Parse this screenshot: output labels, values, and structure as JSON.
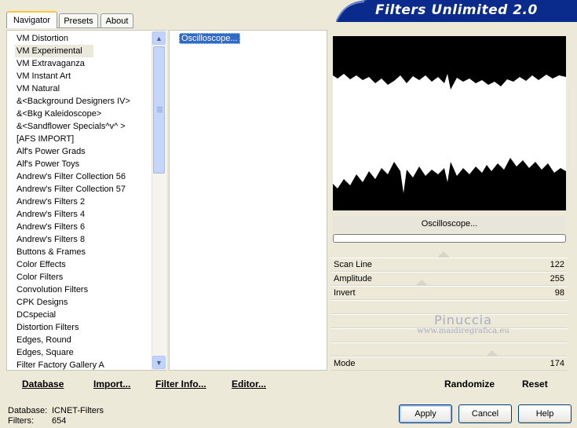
{
  "tabs": [
    {
      "label": "Navigator",
      "active": true
    },
    {
      "label": "Presets",
      "active": false
    },
    {
      "label": "About",
      "active": false
    }
  ],
  "title": "Filters Unlimited 2.0",
  "categories": [
    {
      "label": "VM Distortion",
      "selected": false
    },
    {
      "label": "VM Experimental",
      "selected": true
    },
    {
      "label": "VM Extravaganza",
      "selected": false
    },
    {
      "label": "VM Instant Art",
      "selected": false
    },
    {
      "label": "VM Natural",
      "selected": false
    },
    {
      "label": "&<Background Designers IV>",
      "selected": false
    },
    {
      "label": "&<Bkg Kaleidoscope>",
      "selected": false
    },
    {
      "label": "&<Sandflower Specials^v^ >",
      "selected": false
    },
    {
      "label": "[AFS IMPORT]",
      "selected": false
    },
    {
      "label": "Alf's Power Grads",
      "selected": false
    },
    {
      "label": "Alf's Power Toys",
      "selected": false
    },
    {
      "label": "Andrew's Filter Collection 56",
      "selected": false
    },
    {
      "label": "Andrew's Filter Collection 57",
      "selected": false
    },
    {
      "label": "Andrew's Filters 2",
      "selected": false
    },
    {
      "label": "Andrew's Filters 4",
      "selected": false
    },
    {
      "label": "Andrew's Filters 6",
      "selected": false
    },
    {
      "label": "Andrew's Filters 8",
      "selected": false
    },
    {
      "label": "Buttons & Frames",
      "selected": false
    },
    {
      "label": "Color Effects",
      "selected": false
    },
    {
      "label": "Color Filters",
      "selected": false
    },
    {
      "label": "Convolution Filters",
      "selected": false
    },
    {
      "label": "CPK Designs",
      "selected": false
    },
    {
      "label": "DCspecial",
      "selected": false
    },
    {
      "label": "Distortion Filters",
      "selected": false
    },
    {
      "label": "Edges, Round",
      "selected": false
    },
    {
      "label": "Edges, Square",
      "selected": false
    },
    {
      "label": "Filter Factory Gallery A",
      "selected": false
    }
  ],
  "filters": [
    {
      "label": "Oscilloscope...",
      "selected": true
    }
  ],
  "preview": {
    "filter_name": "Oscilloscope..."
  },
  "params": [
    {
      "label": "Scan Line",
      "value": "122",
      "level": 0.478
    },
    {
      "label": "Amplitude",
      "value": "255",
      "level": 1.0
    },
    {
      "label": "Invert",
      "value": "98",
      "level": 0.384
    },
    {
      "label": "",
      "value": "",
      "level": null
    },
    {
      "label": "",
      "value": "",
      "level": null
    },
    {
      "label": "",
      "value": "",
      "level": null
    },
    {
      "label": "",
      "value": "",
      "level": null
    },
    {
      "label": "Mode",
      "value": "174",
      "level": 0.682
    }
  ],
  "watermark": {
    "line1": "Pinuccia",
    "line2": "www.maidiregrafica.eu"
  },
  "toolbar": {
    "database": "Database",
    "import": "Import...",
    "filter_info": "Filter Info...",
    "editor": "Editor...",
    "randomize": "Randomize",
    "reset": "Reset"
  },
  "status": {
    "database_label": "Database:",
    "database_value": "ICNET-Filters",
    "filters_label": "Filters:",
    "filters_value": "654"
  },
  "buttons": {
    "apply": "Apply",
    "cancel": "Cancel",
    "help": "Help"
  },
  "colors": {
    "banner": "#0a2a8c",
    "selection": "#316ac5",
    "tab_highlight": "#ffc83c"
  }
}
